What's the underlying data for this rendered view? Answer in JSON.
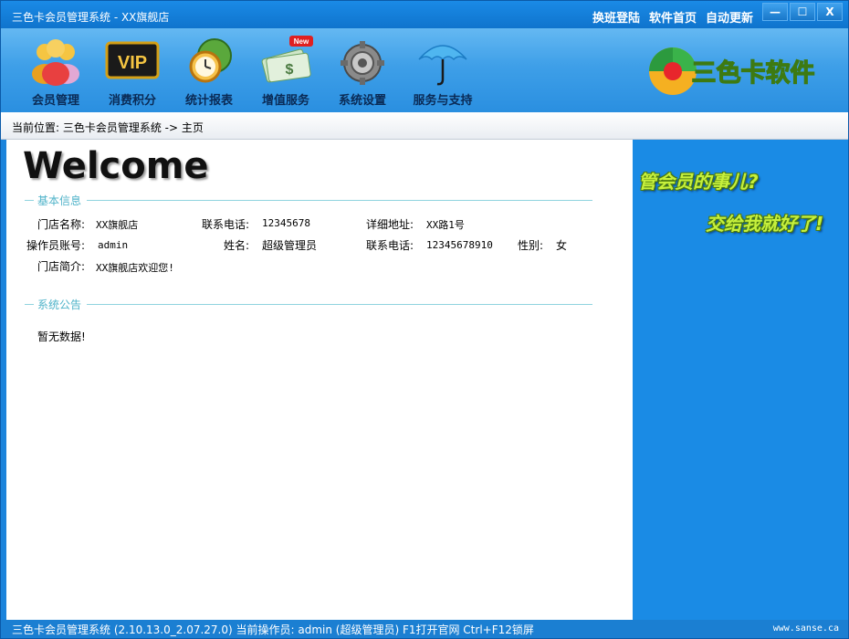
{
  "window": {
    "title": "三色卡会员管理系统 - XX旗舰店",
    "links": [
      "换班登陆",
      "软件首页",
      "自动更新"
    ],
    "controls": [
      "—",
      "☐",
      "X"
    ]
  },
  "toolbar": {
    "items": [
      {
        "label": "会员管理",
        "icon": "members-icon"
      },
      {
        "label": "消费积分",
        "icon": "vip-icon"
      },
      {
        "label": "统计报表",
        "icon": "clock-globe-icon"
      },
      {
        "label": "增值服务",
        "icon": "money-new-icon"
      },
      {
        "label": "系统设置",
        "icon": "gear-icon"
      },
      {
        "label": "服务与支持",
        "icon": "umbrella-icon"
      }
    ],
    "new_badge": "New",
    "vip_text": "VIP",
    "brand": "三色卡软件"
  },
  "breadcrumb": "当前位置: 三色卡会员管理系统 -> 主页",
  "main": {
    "welcome": "Welcome",
    "basic_info": {
      "title": "基本信息",
      "store_name_label": "门店名称:",
      "store_name": "XX旗舰店",
      "phone_label": "联系电话:",
      "phone": "12345678",
      "address_label": "详细地址:",
      "address": "XX路1号",
      "operator_account_label": "操作员账号:",
      "operator_account": "admin",
      "name_label": "姓名:",
      "name": "超级管理员",
      "op_phone_label": "联系电话:",
      "op_phone": "12345678910",
      "gender_label": "性别:",
      "gender": "女",
      "intro_label": "门店简介:",
      "intro": "XX旗舰店欢迎您!"
    },
    "notice": {
      "title": "系统公告",
      "empty": "暂无数据!"
    }
  },
  "sidebar": {
    "line1": "管会员的事儿?",
    "line2": "交给我就好了!"
  },
  "statusbar": {
    "text": "三色卡会员管理系统 (2.10.13.0_2.07.27.0)  当前操作员: admin (超级管理员)  F1打开官网 Ctrl+F12锁屏",
    "site": "www.sanse.ca"
  },
  "colors": {
    "accent": "#1b84dc",
    "slogan": "#c6f03c",
    "section_line": "#8fd3df"
  }
}
